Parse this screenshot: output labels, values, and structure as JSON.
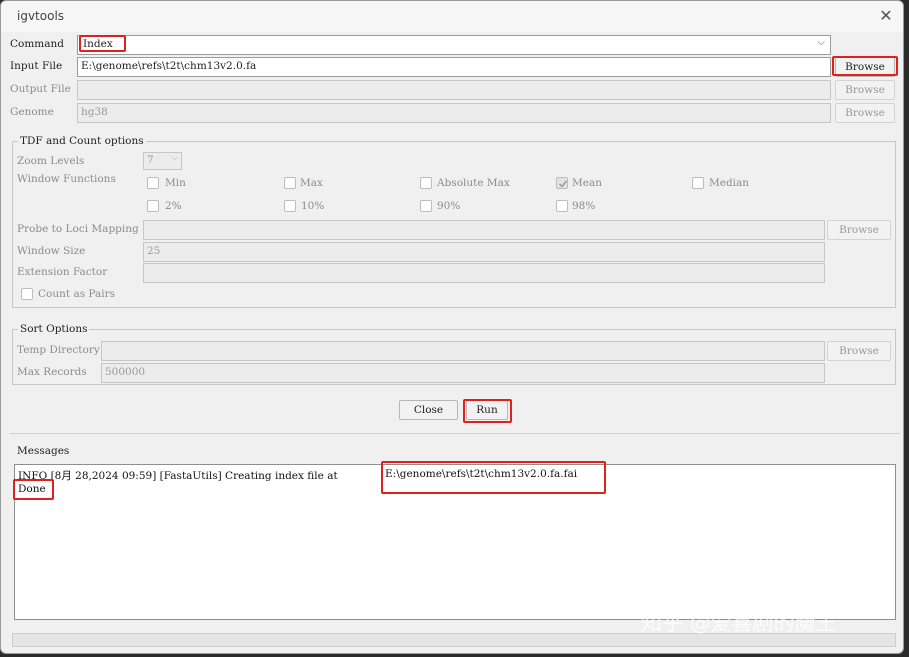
{
  "window": {
    "title": "igvtools"
  },
  "command": {
    "label": "Command",
    "value": "Index"
  },
  "input_file": {
    "label": "Input File",
    "value": "E:\\genome\\refs\\t2t\\chm13v2.0.fa",
    "browse": "Browse"
  },
  "output_file": {
    "label": "Output File",
    "value": "",
    "browse": "Browse"
  },
  "genome": {
    "label": "Genome",
    "value": "hg38",
    "browse": "Browse"
  },
  "tdf": {
    "legend": "TDF and Count options",
    "zoom_label": "Zoom Levels",
    "zoom_value": "7",
    "window_functions_label": "Window Functions",
    "functions": [
      {
        "label": "Min",
        "checked": false
      },
      {
        "label": "Max",
        "checked": false
      },
      {
        "label": "Absolute Max",
        "checked": false
      },
      {
        "label": "Mean",
        "checked": true
      },
      {
        "label": "Median",
        "checked": false
      },
      {
        "label": "2%",
        "checked": false
      },
      {
        "label": "10%",
        "checked": false
      },
      {
        "label": "90%",
        "checked": false
      },
      {
        "label": "98%",
        "checked": false
      }
    ],
    "probe_label": "Probe to Loci Mapping",
    "probe_browse": "Browse",
    "window_size_label": "Window Size",
    "window_size_value": "25",
    "extension_label": "Extension Factor",
    "extension_value": "",
    "count_pairs_label": "Count as Pairs"
  },
  "sort": {
    "legend": "Sort Options",
    "temp_dir_label": "Temp Directory",
    "temp_dir_value": "",
    "temp_browse": "Browse",
    "max_records_label": "Max Records",
    "max_records_value": "500000"
  },
  "actions": {
    "close": "Close",
    "run": "Run"
  },
  "messages": {
    "label": "Messages",
    "line1_prefix": "INFO [8月 28,2024 09:59] [FastaUtils] Creating index file at ",
    "line1_path": "E:\\genome\\refs\\t2t\\chm13v2.0.fa.fai",
    "line2": "Done"
  },
  "watermark": "知乎 @爱喜剧的魔王",
  "colors": {
    "highlight": "#e0201c",
    "window_bg": "#f0f0f0"
  }
}
